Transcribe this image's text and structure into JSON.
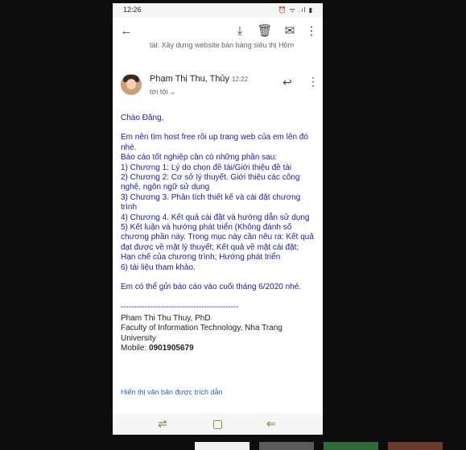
{
  "status": {
    "time": "12:26",
    "icons": "⏰ ᯤ .ıl ▮"
  },
  "toolbar": {
    "back": "←",
    "archive": "⤓",
    "delete": "🗑",
    "mail": "✉",
    "more": "⋮"
  },
  "thread": {
    "previous_subject": "tài: Xây dựng website bán hàng siêu thị Hồm"
  },
  "message": {
    "sender": "Phạm Thị Thu, Thủy",
    "time": "12:22",
    "to": "tới tôi ⌄",
    "reply": "↩",
    "more": "⋮"
  },
  "body": {
    "greeting": "Chào Đăng,",
    "lines": [
      "Em nên tìm host free rồi up trang web của  em lên đó nhé.",
      "Báo cáo tốt nghiệp cần có những phần sau:",
      "1) Chương 1: Lý do chọn đề tài/Giới thiệu đề tài",
      "2) Chương 2: Cơ sở lý thuyết. Giới thiệu các công nghệ, ngôn ngữ sử dụng",
      "3) Chương 3. Phân tích thiết kế và cài đặt chương trình",
      "4) Chương 4. Kết quả cài đặt và hướng dẫn sử dụng",
      "5) Kết luận và hướng phát triển (Không đánh số chương phần này. Trong mục này cần nêu ra: Kết quả đạt được về mặt lý thuyết; Kết quả về mặt cài đặt; Hạn chế của chương trình; Hướng phát triển",
      "6) tài liệu tham khảo."
    ],
    "closing": "Em có thể gửi báo cáo vào cuối tháng 6/2020 nhé.",
    "divider": "--------------------------------------------"
  },
  "signature": {
    "name": "Pham Thi Thu Thuy, PhD",
    "org": "Faculty of Information Technology, Nha Trang University",
    "mobile_label": "Mobile: ",
    "mobile_number": "0901905679"
  },
  "quoted_link": "Hiển thị văn bản được trích dẫn",
  "navbar": {
    "recent": "⇌",
    "home": "▢",
    "back": "⇐"
  }
}
